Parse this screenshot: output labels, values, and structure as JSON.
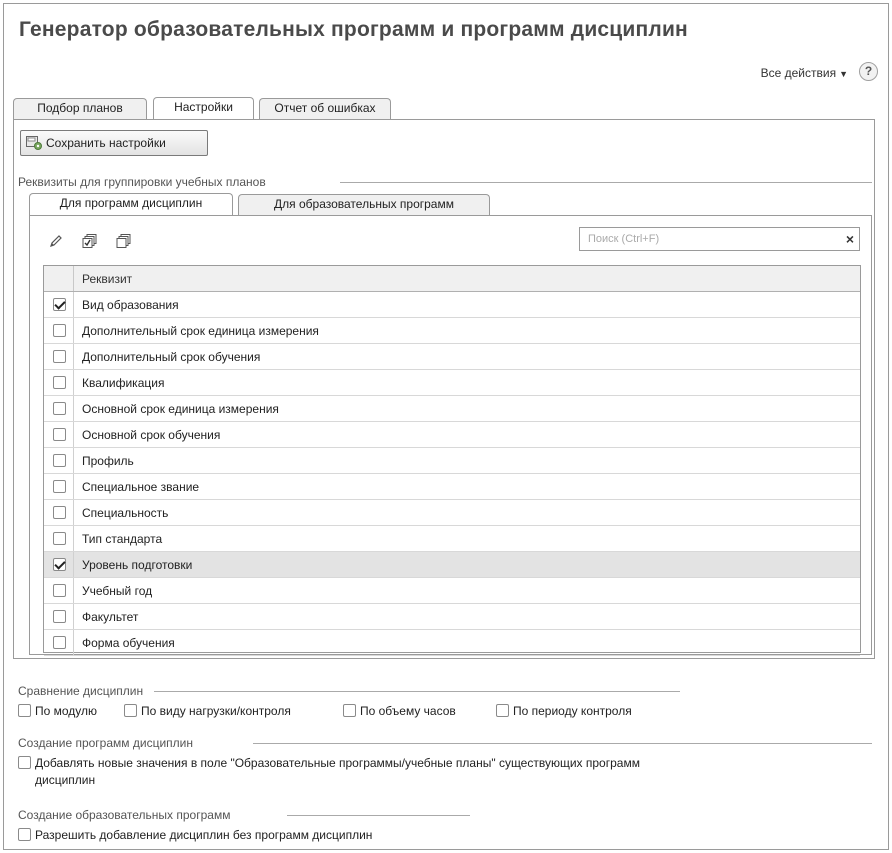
{
  "window": {
    "title": "Генератор образовательных программ и программ дисциплин",
    "all_actions": "Все действия",
    "help": "?"
  },
  "tabs": [
    {
      "label": "Подбор планов",
      "active": false
    },
    {
      "label": "Настройки",
      "active": true
    },
    {
      "label": "Отчет об ошибках",
      "active": false
    }
  ],
  "toolbar": {
    "save_label": "Сохранить настройки"
  },
  "grouping": {
    "label": "Реквизиты для группировки учебных планов",
    "subtabs": [
      {
        "label": "Для программ дисциплин",
        "active": true
      },
      {
        "label": "Для образовательных программ",
        "active": false
      }
    ],
    "icons": [
      "edit-icon",
      "check-all-icon",
      "uncheck-all-icon"
    ],
    "search_placeholder": "Поиск (Ctrl+F)",
    "clear": "×",
    "column_header": "Реквизит",
    "rows": [
      {
        "label": "Вид образования",
        "checked": true
      },
      {
        "label": "Дополнительный срок единица измерения",
        "checked": false
      },
      {
        "label": "Дополнительный срок обучения",
        "checked": false
      },
      {
        "label": "Квалификация",
        "checked": false
      },
      {
        "label": "Основной срок единица измерения",
        "checked": false
      },
      {
        "label": "Основной срок обучения",
        "checked": false
      },
      {
        "label": "Профиль",
        "checked": false
      },
      {
        "label": "Специальное звание",
        "checked": false
      },
      {
        "label": "Специальность",
        "checked": false
      },
      {
        "label": "Тип стандарта",
        "checked": false
      },
      {
        "label": "Уровень подготовки",
        "checked": true,
        "selected": true
      },
      {
        "label": "Учебный год",
        "checked": false
      },
      {
        "label": "Факультет",
        "checked": false
      },
      {
        "label": "Форма обучения",
        "checked": false
      }
    ]
  },
  "compare": {
    "label": "Сравнение дисциплин",
    "options": [
      {
        "label": "По модулю",
        "checked": false
      },
      {
        "label": "По виду нагрузки/контроля",
        "checked": false
      },
      {
        "label": "По объему часов",
        "checked": false
      },
      {
        "label": "По периоду контроля",
        "checked": false
      }
    ]
  },
  "create_disc": {
    "label": "Создание программ дисциплин",
    "option_line1": "Добавлять новые значения в поле \"Образовательные программы/учебные планы\" существующих программ",
    "option_line2": "дисциплин",
    "checked": false
  },
  "create_edu": {
    "label": "Создание образовательных программ",
    "option": "Разрешить добавление дисциплин без программ дисциплин",
    "checked": false
  }
}
